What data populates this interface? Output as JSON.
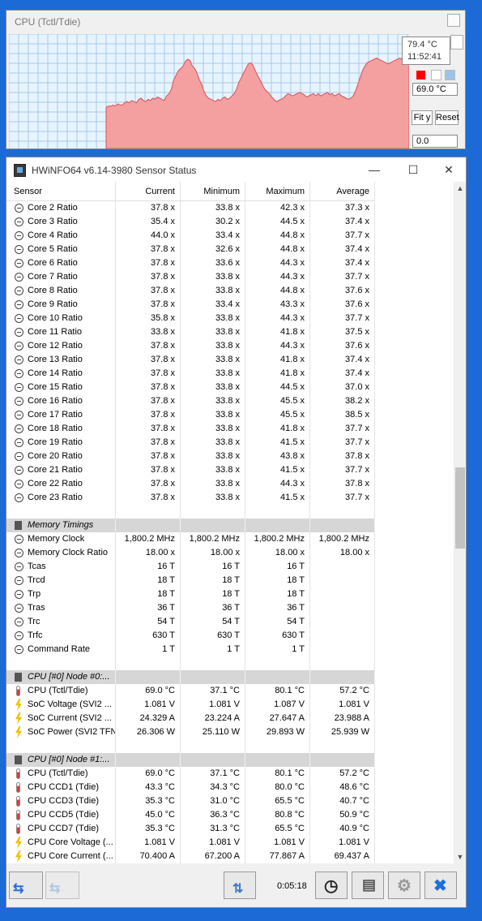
{
  "graph": {
    "title": "CPU (Tctl/Tdie)",
    "tooltip_value": "79.4 °C",
    "tooltip_time": "11:52:41",
    "current_value": "69.0 °C",
    "min_value": "0.0",
    "fit_label": "Fit y",
    "reset_label": "Reset",
    "line_color": "#d8505a",
    "fill_color": "#f4a0a0",
    "bg_color": "#e6f4ff",
    "grid_color": "#a8c8e6",
    "trace": [
      36,
      37,
      37,
      38,
      37,
      39,
      38,
      38,
      40,
      41,
      40,
      42,
      41,
      40,
      43,
      44,
      42,
      41,
      43,
      42,
      44,
      43,
      45,
      44,
      43,
      42,
      46,
      48,
      52,
      60,
      64,
      68,
      70,
      72,
      76,
      78,
      77,
      72,
      70,
      66,
      60,
      56,
      50,
      46,
      44,
      43,
      42,
      41,
      43,
      42,
      44,
      45,
      43,
      44,
      46,
      48,
      52,
      58,
      62,
      66,
      70,
      74,
      75,
      73,
      68,
      64,
      60,
      56,
      52,
      50,
      48,
      45,
      43,
      41,
      42,
      43,
      44,
      46,
      48,
      47,
      46,
      47,
      48,
      49,
      48,
      47,
      45,
      46,
      47,
      48,
      46,
      48,
      46,
      47,
      48,
      49,
      47,
      48,
      46,
      47,
      48,
      46,
      45,
      44,
      43,
      44,
      46,
      50,
      56,
      62,
      68,
      72,
      75,
      76,
      77,
      78,
      79,
      78,
      77,
      76,
      75,
      74,
      75,
      76,
      77,
      78,
      79,
      78,
      79,
      80,
      80
    ]
  },
  "window": {
    "title": "HWiNFO64 v6.14-3980 Sensor Status",
    "min_symbol": "—",
    "max_symbol": "☐",
    "close_symbol": "✕"
  },
  "table": {
    "headers": [
      "Sensor",
      "Current",
      "Minimum",
      "Maximum",
      "Average"
    ],
    "rows": [
      {
        "icon": "clock",
        "name": "Core 2 Ratio",
        "cur": "37.8 x",
        "min": "33.8 x",
        "max": "42.3 x",
        "avg": "37.3 x"
      },
      {
        "icon": "clock",
        "name": "Core 3 Ratio",
        "cur": "35.4 x",
        "min": "30.2 x",
        "max": "44.5 x",
        "avg": "37.4 x"
      },
      {
        "icon": "clock",
        "name": "Core 4 Ratio",
        "cur": "44.0 x",
        "min": "33.4 x",
        "max": "44.8 x",
        "avg": "37.7 x"
      },
      {
        "icon": "clock",
        "name": "Core 5 Ratio",
        "cur": "37.8 x",
        "min": "32.6 x",
        "max": "44.8 x",
        "avg": "37.4 x"
      },
      {
        "icon": "clock",
        "name": "Core 6 Ratio",
        "cur": "37.8 x",
        "min": "33.6 x",
        "max": "44.3 x",
        "avg": "37.4 x"
      },
      {
        "icon": "clock",
        "name": "Core 7 Ratio",
        "cur": "37.8 x",
        "min": "33.8 x",
        "max": "44.3 x",
        "avg": "37.7 x"
      },
      {
        "icon": "clock",
        "name": "Core 8 Ratio",
        "cur": "37.8 x",
        "min": "33.8 x",
        "max": "44.8 x",
        "avg": "37.6 x"
      },
      {
        "icon": "clock",
        "name": "Core 9 Ratio",
        "cur": "37.8 x",
        "min": "33.4 x",
        "max": "43.3 x",
        "avg": "37.6 x"
      },
      {
        "icon": "clock",
        "name": "Core 10 Ratio",
        "cur": "35.8 x",
        "min": "33.8 x",
        "max": "44.3 x",
        "avg": "37.7 x"
      },
      {
        "icon": "clock",
        "name": "Core 11 Ratio",
        "cur": "33.8 x",
        "min": "33.8 x",
        "max": "41.8 x",
        "avg": "37.5 x"
      },
      {
        "icon": "clock",
        "name": "Core 12 Ratio",
        "cur": "37.8 x",
        "min": "33.8 x",
        "max": "44.3 x",
        "avg": "37.6 x"
      },
      {
        "icon": "clock",
        "name": "Core 13 Ratio",
        "cur": "37.8 x",
        "min": "33.8 x",
        "max": "41.8 x",
        "avg": "37.4 x"
      },
      {
        "icon": "clock",
        "name": "Core 14 Ratio",
        "cur": "37.8 x",
        "min": "33.8 x",
        "max": "41.8 x",
        "avg": "37.4 x"
      },
      {
        "icon": "clock",
        "name": "Core 15 Ratio",
        "cur": "37.8 x",
        "min": "33.8 x",
        "max": "44.5 x",
        "avg": "37.0 x"
      },
      {
        "icon": "clock",
        "name": "Core 16 Ratio",
        "cur": "37.8 x",
        "min": "33.8 x",
        "max": "45.5 x",
        "avg": "38.2 x"
      },
      {
        "icon": "clock",
        "name": "Core 17 Ratio",
        "cur": "37.8 x",
        "min": "33.8 x",
        "max": "45.5 x",
        "avg": "38.5 x"
      },
      {
        "icon": "clock",
        "name": "Core 18 Ratio",
        "cur": "37.8 x",
        "min": "33.8 x",
        "max": "41.8 x",
        "avg": "37.7 x"
      },
      {
        "icon": "clock",
        "name": "Core 19 Ratio",
        "cur": "37.8 x",
        "min": "33.8 x",
        "max": "41.5 x",
        "avg": "37.7 x"
      },
      {
        "icon": "clock",
        "name": "Core 20 Ratio",
        "cur": "37.8 x",
        "min": "33.8 x",
        "max": "43.8 x",
        "avg": "37.8 x"
      },
      {
        "icon": "clock",
        "name": "Core 21 Ratio",
        "cur": "37.8 x",
        "min": "33.8 x",
        "max": "41.5 x",
        "avg": "37.7 x"
      },
      {
        "icon": "clock",
        "name": "Core 22 Ratio",
        "cur": "37.8 x",
        "min": "33.8 x",
        "max": "44.3 x",
        "avg": "37.8 x"
      },
      {
        "icon": "clock",
        "name": "Core 23 Ratio",
        "cur": "37.8 x",
        "min": "33.8 x",
        "max": "41.5 x",
        "avg": "37.7 x"
      },
      {
        "icon": "",
        "name": "",
        "cur": "",
        "min": "",
        "max": "",
        "avg": ""
      },
      {
        "icon": "chip",
        "group": true,
        "name": "Memory Timings",
        "cur": "",
        "min": "",
        "max": "",
        "avg": ""
      },
      {
        "icon": "clock",
        "name": "Memory Clock",
        "cur": "1,800.2 MHz",
        "min": "1,800.2 MHz",
        "max": "1,800.2 MHz",
        "avg": "1,800.2 MHz"
      },
      {
        "icon": "clock",
        "name": "Memory Clock Ratio",
        "cur": "18.00 x",
        "min": "18.00 x",
        "max": "18.00 x",
        "avg": "18.00 x"
      },
      {
        "icon": "clock",
        "name": "Tcas",
        "cur": "16 T",
        "min": "16 T",
        "max": "16 T",
        "avg": ""
      },
      {
        "icon": "clock",
        "name": "Trcd",
        "cur": "18 T",
        "min": "18 T",
        "max": "18 T",
        "avg": ""
      },
      {
        "icon": "clock",
        "name": "Trp",
        "cur": "18 T",
        "min": "18 T",
        "max": "18 T",
        "avg": ""
      },
      {
        "icon": "clock",
        "name": "Tras",
        "cur": "36 T",
        "min": "36 T",
        "max": "36 T",
        "avg": ""
      },
      {
        "icon": "clock",
        "name": "Trc",
        "cur": "54 T",
        "min": "54 T",
        "max": "54 T",
        "avg": ""
      },
      {
        "icon": "clock",
        "name": "Trfc",
        "cur": "630 T",
        "min": "630 T",
        "max": "630 T",
        "avg": ""
      },
      {
        "icon": "clock",
        "name": "Command Rate",
        "cur": "1 T",
        "min": "1 T",
        "max": "1 T",
        "avg": ""
      },
      {
        "icon": "",
        "name": "",
        "cur": "",
        "min": "",
        "max": "",
        "avg": ""
      },
      {
        "icon": "chip",
        "group": true,
        "name": "CPU [#0] Node #0:...",
        "cur": "",
        "min": "",
        "max": "",
        "avg": ""
      },
      {
        "icon": "therm",
        "name": "CPU (Tctl/Tdie)",
        "cur": "69.0 °C",
        "min": "37.1 °C",
        "max": "80.1 °C",
        "avg": "57.2 °C"
      },
      {
        "icon": "bolt",
        "name": "SoC Voltage (SVI2 ...",
        "cur": "1.081 V",
        "min": "1.081 V",
        "max": "1.087 V",
        "avg": "1.081 V"
      },
      {
        "icon": "bolt",
        "name": "SoC Current (SVI2 ...",
        "cur": "24.329 A",
        "min": "23.224 A",
        "max": "27.647 A",
        "avg": "23.988 A"
      },
      {
        "icon": "bolt",
        "name": "SoC Power (SVI2 TFN)",
        "cur": "26.306 W",
        "min": "25.110 W",
        "max": "29.893 W",
        "avg": "25.939 W"
      },
      {
        "icon": "",
        "name": "",
        "cur": "",
        "min": "",
        "max": "",
        "avg": ""
      },
      {
        "icon": "chip",
        "group": true,
        "name": "CPU [#0] Node #1:...",
        "cur": "",
        "min": "",
        "max": "",
        "avg": ""
      },
      {
        "icon": "therm",
        "name": "CPU (Tctl/Tdie)",
        "cur": "69.0 °C",
        "min": "37.1 °C",
        "max": "80.1 °C",
        "avg": "57.2 °C"
      },
      {
        "icon": "therm",
        "name": "CPU CCD1 (Tdie)",
        "cur": "43.3 °C",
        "min": "34.3 °C",
        "max": "80.0 °C",
        "avg": "48.6 °C"
      },
      {
        "icon": "therm",
        "name": "CPU CCD3 (Tdie)",
        "cur": "35.3 °C",
        "min": "31.0 °C",
        "max": "65.5 °C",
        "avg": "40.7 °C"
      },
      {
        "icon": "therm",
        "name": "CPU CCD5 (Tdie)",
        "cur": "45.0 °C",
        "min": "36.3 °C",
        "max": "80.8 °C",
        "avg": "50.9 °C"
      },
      {
        "icon": "therm",
        "name": "CPU CCD7 (Tdie)",
        "cur": "35.3 °C",
        "min": "31.3 °C",
        "max": "65.5 °C",
        "avg": "40.9 °C"
      },
      {
        "icon": "bolt",
        "name": "CPU Core Voltage (...",
        "cur": "1.081 V",
        "min": "1.081 V",
        "max": "1.081 V",
        "avg": "1.081 V"
      },
      {
        "icon": "bolt",
        "name": "CPU Core Current (...",
        "cur": "70.400 A",
        "min": "67.200 A",
        "max": "77.867 A",
        "avg": "69.437 A"
      }
    ]
  },
  "toolbar": {
    "timer": "0:05:18",
    "nav_left_icon": "arrows-left-right-icon",
    "nav_right_icon": "arrows-disabled-icon",
    "network_icon": "network-icon",
    "clock_icon": "stopwatch-icon",
    "report_icon": "report-icon",
    "settings_icon": "gear-icon",
    "exit_icon": "close-x-icon"
  }
}
